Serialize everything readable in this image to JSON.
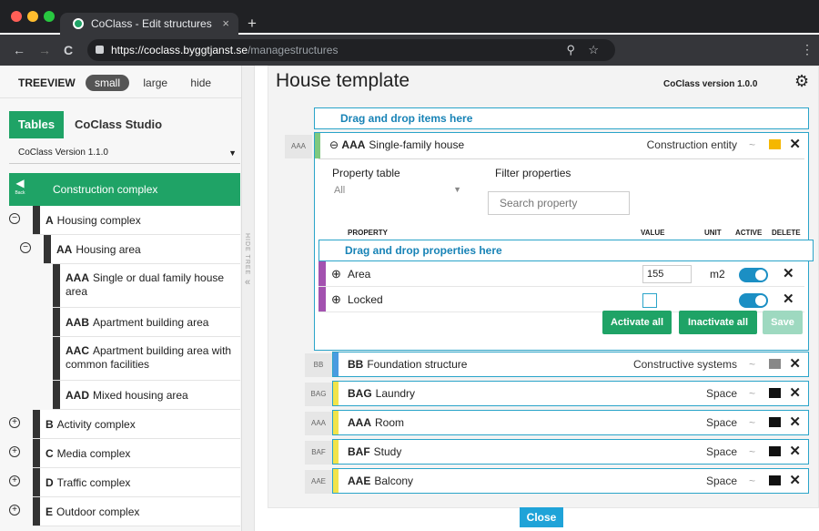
{
  "browser": {
    "tab_title": "CoClass - Edit structures",
    "tab_close": "×",
    "new_tab": "+",
    "url_host": "https://coclass.byggtjanst.se",
    "url_path": "/managestructures",
    "back": "←",
    "forward": "→",
    "reload": "C",
    "search": "⚲",
    "star": "☆",
    "menu": "⋮"
  },
  "sidebar": {
    "treeview_label": "TREEVIEW",
    "size_small": "small",
    "size_large": "large",
    "hide": "hide",
    "tab_tables": "Tables",
    "tab_studio": "CoClass Studio",
    "version_select": "CoClass Version 1.1.0",
    "back_short": "Back",
    "current": "Construction complex",
    "hide_tree": "HIDE TREE",
    "collapse_arrow": "«",
    "items": [
      {
        "code": "A",
        "label": "Housing complex",
        "toggle": "−"
      },
      {
        "code": "AA",
        "label": "Housing area",
        "toggle": "−"
      },
      {
        "code": "AAA",
        "label": "Single or dual family house area"
      },
      {
        "code": "AAB",
        "label": "Apartment building area"
      },
      {
        "code": "AAC",
        "label": "Apartment building area with common facilities"
      },
      {
        "code": "AAD",
        "label": "Mixed housing area"
      },
      {
        "code": "B",
        "label": "Activity complex",
        "toggle": "+"
      },
      {
        "code": "C",
        "label": "Media complex",
        "toggle": "+"
      },
      {
        "code": "D",
        "label": "Traffic complex",
        "toggle": "+"
      },
      {
        "code": "E",
        "label": "Outdoor complex",
        "toggle": "+"
      }
    ]
  },
  "main": {
    "title": "House template",
    "version": "CoClass version 1.0.0",
    "drop_items": "Drag and drop items here",
    "expanded": {
      "tag": "AAA",
      "toggle": "⊖",
      "code": "AAA",
      "name": "Single-family house",
      "type": "Construction entity",
      "property_table_label": "Property table",
      "property_table_value": "All",
      "filter_label": "Filter properties",
      "search_placeholder": "Search property",
      "headers": {
        "property": "PROPERTY",
        "value": "VALUE",
        "unit": "UNIT",
        "active": "ACTIVE",
        "delete": "DELETE"
      },
      "drop_props": "Drag and drop properties here",
      "properties": [
        {
          "name": "Area",
          "value": "155",
          "unit": "m2",
          "active": true
        },
        {
          "name": "Locked",
          "value": "",
          "unit": "",
          "active": true
        }
      ],
      "btn_activate": "Activate all",
      "btn_inactivate": "Inactivate all",
      "btn_save": "Save"
    },
    "rows": [
      {
        "tag": "BB",
        "code": "BB",
        "name": "Foundation structure",
        "type": "Constructive systems",
        "accent": "#4a9be0"
      },
      {
        "tag": "BAG",
        "code": "BAG",
        "name": "Laundry",
        "type": "Space",
        "accent": "#f2e44a"
      },
      {
        "tag": "AAA",
        "code": "AAA",
        "name": "Room",
        "type": "Space",
        "accent": "#f2e44a"
      },
      {
        "tag": "BAF",
        "code": "BAF",
        "name": "Study",
        "type": "Space",
        "accent": "#f2e44a"
      },
      {
        "tag": "AAE",
        "code": "AAE",
        "name": "Balcony",
        "type": "Space",
        "accent": "#f2e44a"
      }
    ],
    "icons": {
      "pulse": "~",
      "close": "✕",
      "plus": "⊕"
    },
    "close_button": "Close"
  }
}
